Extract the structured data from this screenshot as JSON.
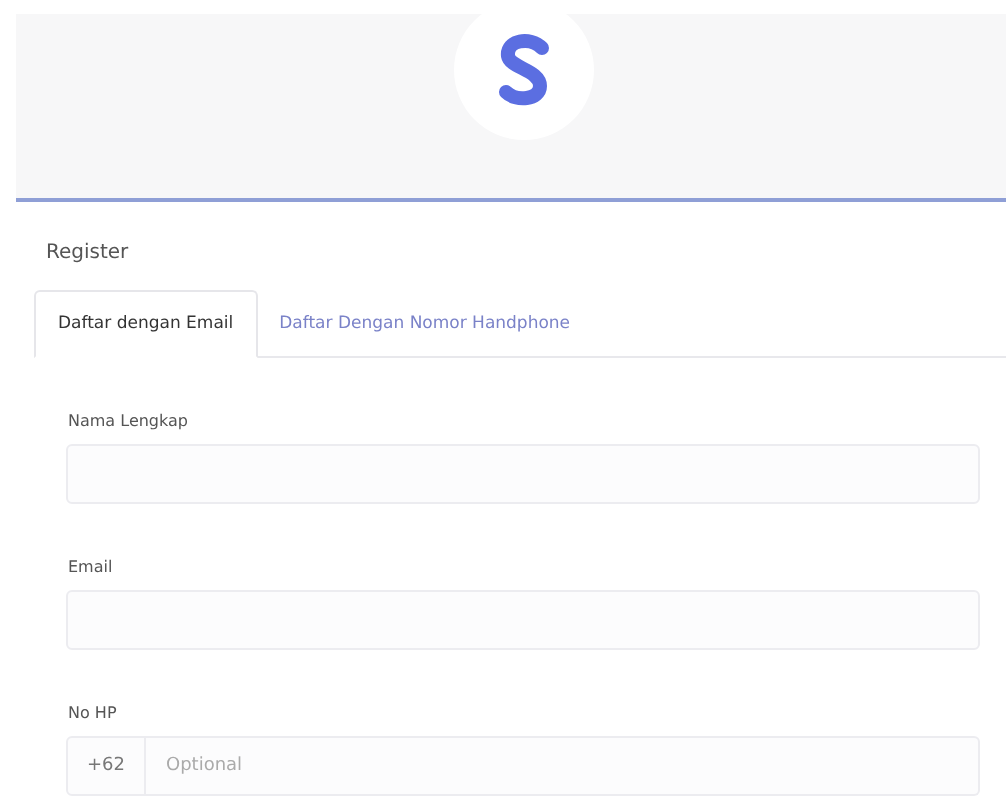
{
  "page_title": "Register",
  "tabs": [
    {
      "label": "Daftar dengan Email",
      "selected": true
    },
    {
      "label": "Daftar Dengan Nomor Handphone",
      "selected": false
    }
  ],
  "fields": [
    {
      "kind": "text",
      "label": "Nama Lengkap"
    },
    {
      "kind": "text",
      "label": "Email"
    },
    {
      "kind": "phone",
      "label": "No HP",
      "prefix": "+62",
      "placeholder": "Optional"
    }
  ]
}
